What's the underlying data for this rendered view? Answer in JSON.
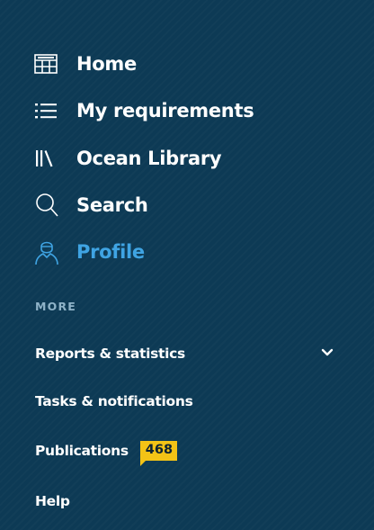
{
  "nav": {
    "items": [
      {
        "label": "Home",
        "icon": "home-grid-icon",
        "active": false
      },
      {
        "label": "My requirements",
        "icon": "list-icon",
        "active": false
      },
      {
        "label": "Ocean Library",
        "icon": "library-icon",
        "active": false
      },
      {
        "label": "Search",
        "icon": "search-icon",
        "active": false
      },
      {
        "label": "Profile",
        "icon": "profile-icon",
        "active": true
      }
    ],
    "active_color": "#3fa4e3"
  },
  "more": {
    "heading": "MORE",
    "items": [
      {
        "label": "Reports & statistics",
        "icon": "chevron-down-icon"
      },
      {
        "label": "Tasks & notifications"
      },
      {
        "label": "Publications",
        "badge": "468"
      },
      {
        "label": "Help"
      }
    ]
  },
  "colors": {
    "background": "#0d3a55",
    "badge": "#f3c316",
    "heading": "#8fb3c8"
  }
}
